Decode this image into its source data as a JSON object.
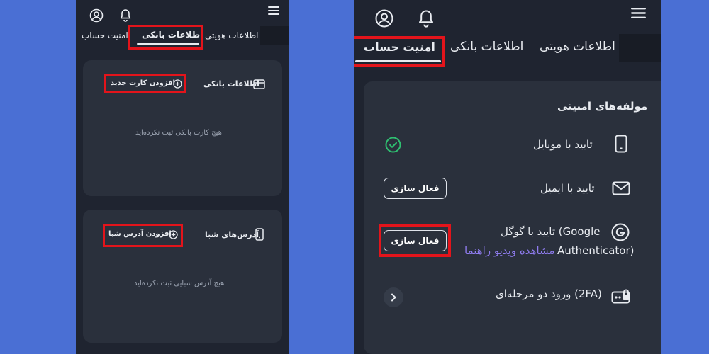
{
  "left": {
    "tabs": [
      {
        "label": "اطلاعات هویتی"
      },
      {
        "label": "اطلاعات بانکی"
      },
      {
        "label": "امنیت حساب"
      }
    ],
    "bank_card": {
      "title": "اطلاعات بانکی",
      "add_button": "افزودن کارت جدید",
      "empty": "هیچ کارت بانکی ثبت نکرده‌اید"
    },
    "sheba_card": {
      "title": "آدرس‌های شبا",
      "add_button": "افزودن آدرس شبا",
      "empty": "هیچ آدرس شبایی ثبت نکرده‌اید"
    }
  },
  "right": {
    "tabs": [
      {
        "label": "اطلاعات هویتی"
      },
      {
        "label": "اطلاعات بانکی"
      },
      {
        "label": "امنیت حساب"
      }
    ],
    "security": {
      "title": "مولفه‌های امنیتی",
      "mobile": {
        "label": "تایید با موبایل"
      },
      "email": {
        "label": "تایید با ایمیل",
        "button": "فعال سازی"
      },
      "google": {
        "label_line1": "تایید با گوگل (Google",
        "label_line2": "Authenticator)",
        "link": "مشاهده ویدیو راهنما",
        "button": "فعال سازی"
      },
      "twofa": {
        "label": "ورود دو مرحله‌ای (2FA)"
      }
    }
  },
  "colors": {
    "background": "#4a6fd4",
    "panel": "#1f2430",
    "card": "#2a303c",
    "highlight": "#e3141b",
    "success": "#2fbf71",
    "link": "#8f7cf0"
  }
}
